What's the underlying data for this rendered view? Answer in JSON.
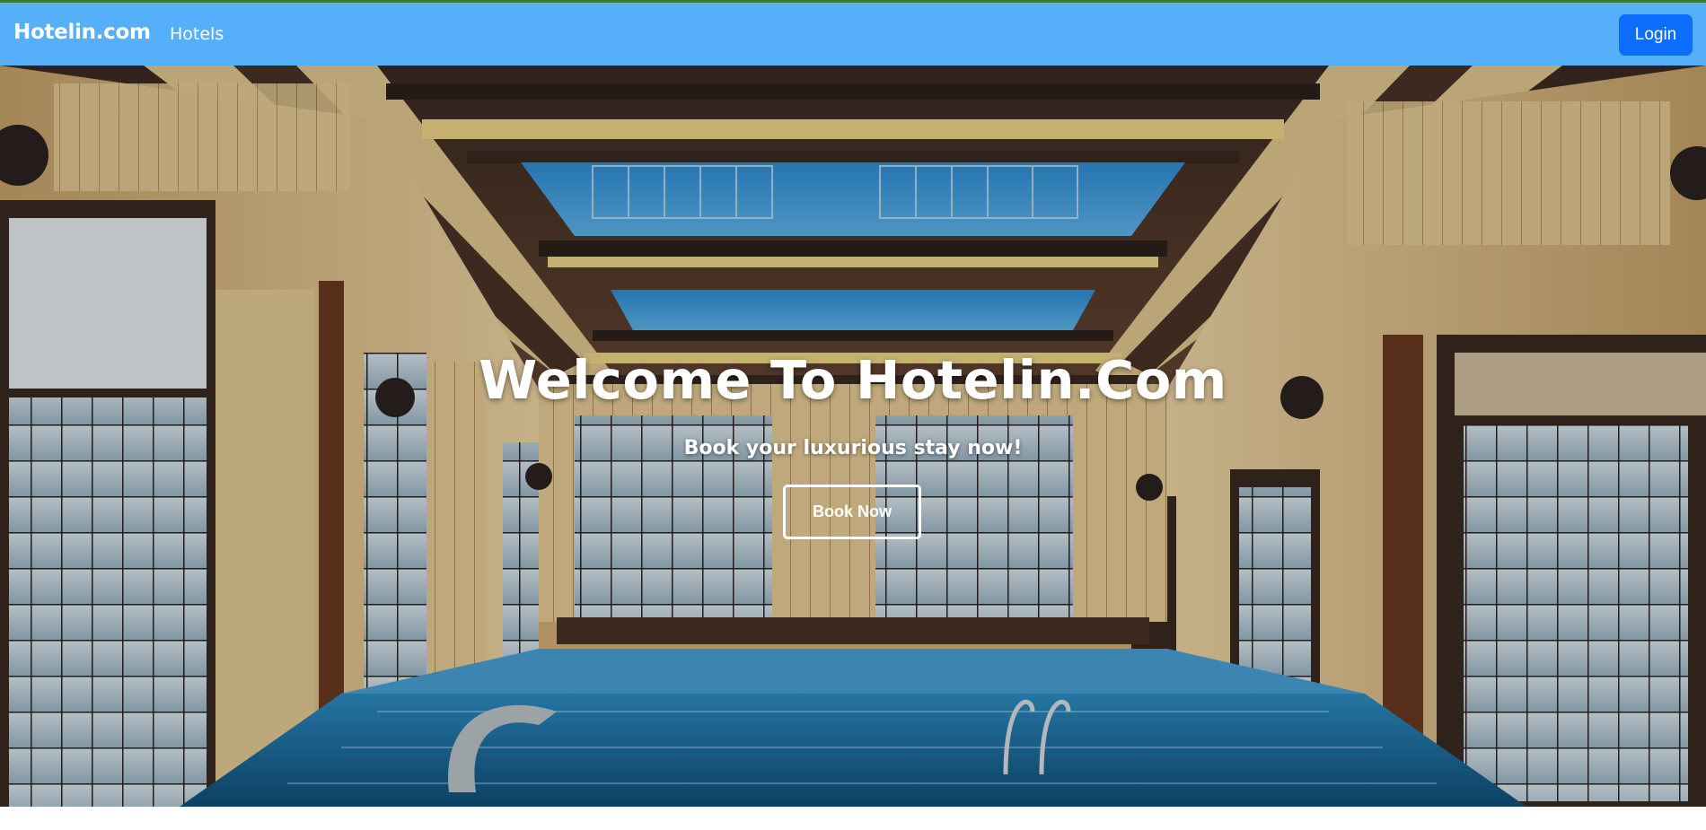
{
  "navbar": {
    "brand": "Hotelin.com",
    "links": [
      {
        "label": "Hotels"
      }
    ],
    "login_label": "Login",
    "background_color": "#56aff9",
    "login_color": "#0d6efd"
  },
  "hero": {
    "title": "Welcome To Hotelin.Com",
    "subtitle": "Book your luxurious stay now!",
    "cta_label": "Book Now"
  }
}
